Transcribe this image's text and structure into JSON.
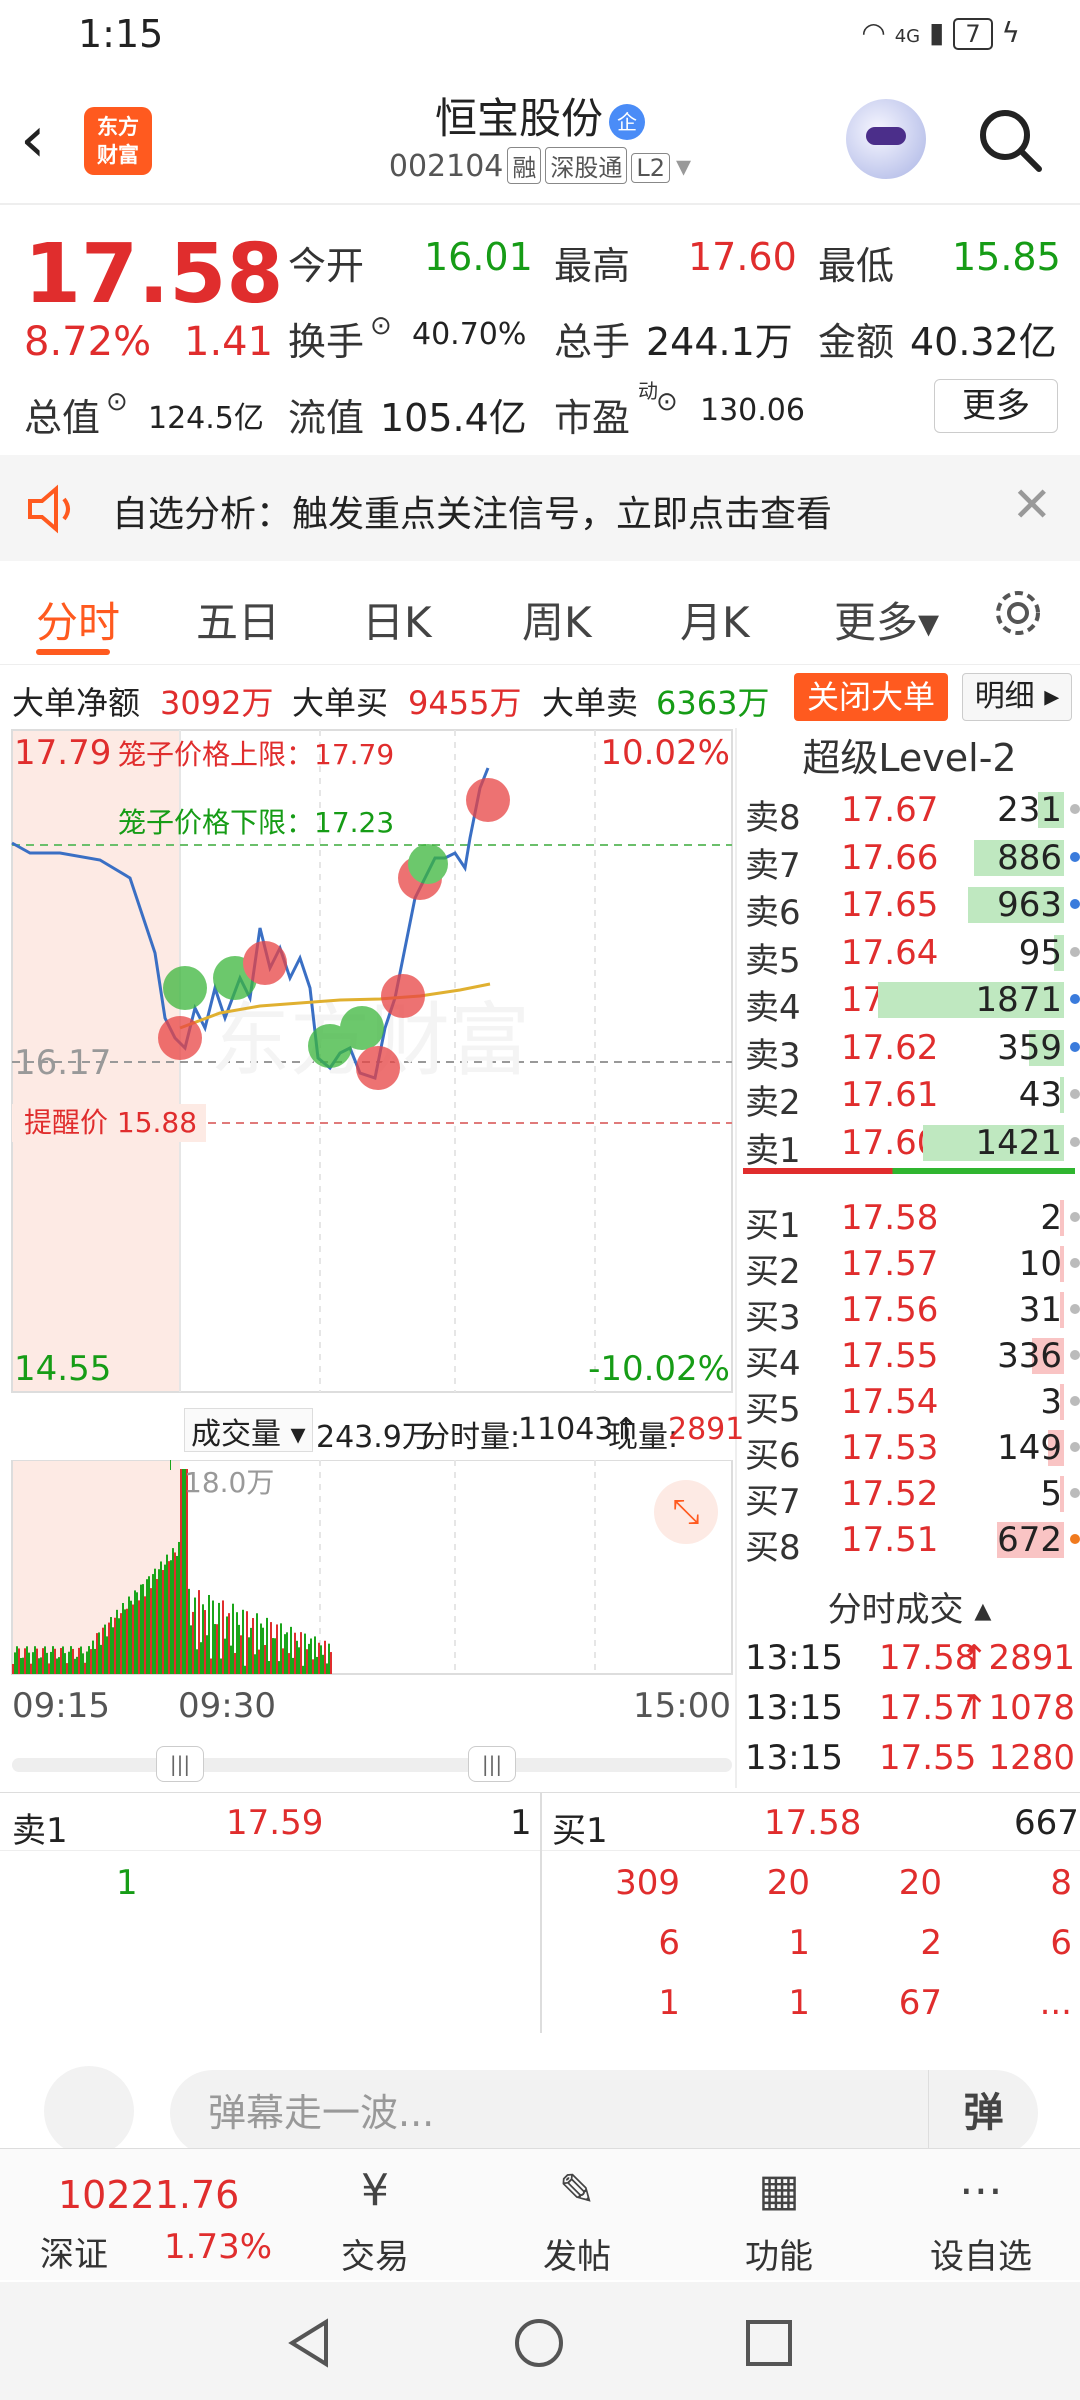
{
  "status": {
    "time": "1:15",
    "signal": "4G",
    "battery": "7"
  },
  "header": {
    "name": "恒宝股份",
    "badge": "企",
    "code": "002104",
    "tags": [
      "融",
      "深股通",
      "L2"
    ],
    "logo_text_top": "东方",
    "logo_text_bottom": "财富"
  },
  "quote": {
    "price": "17.58",
    "pct": "8.72%",
    "change": "1.41",
    "open_label": "今开",
    "open": "16.01",
    "high_label": "最高",
    "high": "17.60",
    "low_label": "最低",
    "low": "15.85",
    "turnover_label": "换手",
    "turnover": "40.70%",
    "volume_label": "总手",
    "volume": "244.1万",
    "amount_label": "金额",
    "amount": "40.32亿",
    "mcap_label": "总值",
    "mcap": "124.5亿",
    "float_label": "流值",
    "float": "105.4亿",
    "pe_label": "市盈",
    "pe_sup": "动",
    "pe": "130.06",
    "more": "更多"
  },
  "banner": {
    "text": "自选分析：触发重点关注信号，立即点击查看"
  },
  "tabs": [
    "分时",
    "五日",
    "日K",
    "周K",
    "月K",
    "更多▾"
  ],
  "bigorder": {
    "net_label": "大单净额",
    "net": "3092万",
    "buy_label": "大单买",
    "buy": "9455万",
    "sell_label": "大单卖",
    "sell": "6363万",
    "close": "关闭大单",
    "detail": "明细 ▸"
  },
  "chart": {
    "top_price": "17.79",
    "bottom_price": "14.55",
    "top_pct": "10.02%",
    "bottom_pct": "-10.02%",
    "upper_limit": "笼子价格上限：17.79",
    "lower_limit": "笼子价格下限：17.23",
    "prev_close": "16.17",
    "alert": "提醒价 15.88",
    "watermark": "东方财富"
  },
  "orderbook": {
    "title": "超级Level-2",
    "sells": [
      {
        "label": "卖8",
        "price": "17.67",
        "vol": "231",
        "bar": 0.08,
        "dot": "g"
      },
      {
        "label": "卖7",
        "price": "17.66",
        "vol": "886",
        "bar": 0.28,
        "dot": "b"
      },
      {
        "label": "卖6",
        "price": "17.65",
        "vol": "963",
        "bar": 0.3,
        "dot": "b"
      },
      {
        "label": "卖5",
        "price": "17.64",
        "vol": "95",
        "bar": 0.03,
        "dot": "g"
      },
      {
        "label": "卖4",
        "price": "17.63",
        "vol": "1871",
        "bar": 0.58,
        "dot": "b"
      },
      {
        "label": "卖3",
        "price": "17.62",
        "vol": "359",
        "bar": 0.11,
        "dot": "b"
      },
      {
        "label": "卖2",
        "price": "17.61",
        "vol": "43",
        "bar": 0.01,
        "dot": "g"
      },
      {
        "label": "卖1",
        "price": "17.60",
        "vol": "1421",
        "bar": 0.44,
        "dot": "g"
      }
    ],
    "buys": [
      {
        "label": "买1",
        "price": "17.58",
        "vol": "2",
        "bar": 0.0,
        "dot": "g"
      },
      {
        "label": "买2",
        "price": "17.57",
        "vol": "10",
        "bar": 0.0,
        "dot": "g"
      },
      {
        "label": "买3",
        "price": "17.56",
        "vol": "31",
        "bar": 0.01,
        "dot": "g"
      },
      {
        "label": "买4",
        "price": "17.55",
        "vol": "336",
        "bar": 0.1,
        "dot": "g"
      },
      {
        "label": "买5",
        "price": "17.54",
        "vol": "3",
        "bar": 0.0,
        "dot": "g"
      },
      {
        "label": "买6",
        "price": "17.53",
        "vol": "149",
        "bar": 0.05,
        "dot": "g"
      },
      {
        "label": "买7",
        "price": "17.52",
        "vol": "5",
        "bar": 0.0,
        "dot": "g"
      },
      {
        "label": "买8",
        "price": "17.51",
        "vol": "672",
        "bar": 0.21,
        "dot": "o"
      }
    ],
    "tick_title": "分时成交",
    "ticks": [
      {
        "time": "13:15",
        "price": "17.58",
        "vol": "↑2891"
      },
      {
        "time": "13:15",
        "price": "17.57",
        "vol": "↑1078"
      },
      {
        "time": "13:15",
        "price": "17.55",
        "vol": "1280"
      }
    ]
  },
  "volume": {
    "selector": "成交量 ▾",
    "total": "243.9万",
    "tick_label": "分时量:",
    "tick_val": "11043↑",
    "now_label": "现量:",
    "now_val": "2891",
    "peak": "18.0万"
  },
  "timeaxis": [
    "09:15",
    "09:30",
    "15:00"
  ],
  "bottomq": {
    "sell_label": "卖1",
    "sell_price": "17.59",
    "sell_count": "1",
    "sell_queue": [
      "1"
    ],
    "buy_label": "买1",
    "buy_price": "17.58",
    "buy_count": "667",
    "buy_queue": [
      [
        "309",
        "20",
        "20",
        "8"
      ],
      [
        "6",
        "1",
        "2",
        "6"
      ],
      [
        "1",
        "1",
        "67",
        "..."
      ]
    ]
  },
  "danmu": {
    "placeholder": "弹幕走一波...",
    "send": "弹"
  },
  "nav": {
    "index_value": "10221.76",
    "index_name": "深证",
    "index_pct": "1.73%",
    "items": [
      "交易",
      "发帖",
      "功能",
      "设自选"
    ]
  }
}
